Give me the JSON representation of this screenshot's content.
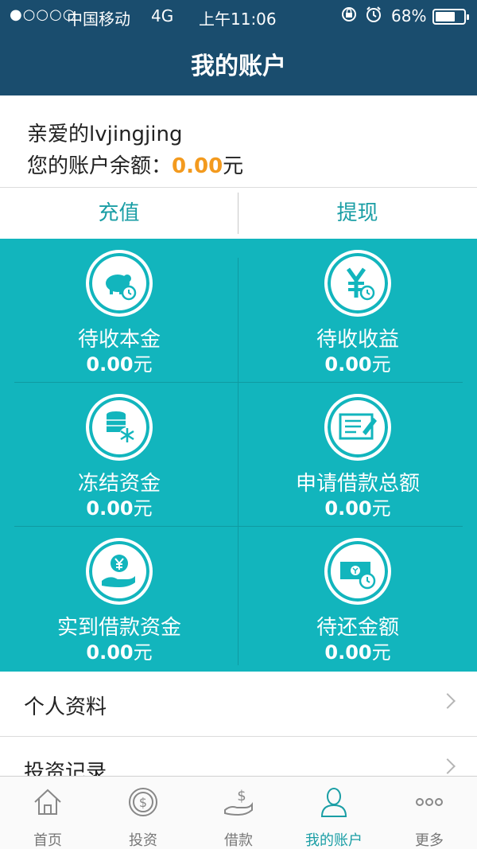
{
  "status_bar": {
    "signal": "●○○○○",
    "carrier": "中国移动",
    "network": "4G",
    "time": "上午11:06",
    "battery": "68%"
  },
  "nav": {
    "title": "我的账户"
  },
  "greeting": {
    "prefix": "亲爱的",
    "username": "lvjingjing",
    "balance_label": "您的账户余额：",
    "balance_value": "0.00",
    "balance_unit": "元"
  },
  "actions": {
    "recharge": "充值",
    "withdraw": "提现"
  },
  "stats": [
    {
      "label": "待收本金",
      "value": "0.00",
      "unit": "元",
      "icon": "piggy-bank-clock-icon"
    },
    {
      "label": "待收收益",
      "value": "0.00",
      "unit": "元",
      "icon": "yuan-clock-icon"
    },
    {
      "label": "冻结资金",
      "value": "0.00",
      "unit": "元",
      "icon": "frozen-coins-icon"
    },
    {
      "label": "申请借款总额",
      "value": "0.00",
      "unit": "元",
      "icon": "loan-application-icon"
    },
    {
      "label": "实到借款资金",
      "value": "0.00",
      "unit": "元",
      "icon": "hand-coin-icon"
    },
    {
      "label": "待还金额",
      "value": "0.00",
      "unit": "元",
      "icon": "money-clock-icon"
    }
  ],
  "menu": [
    {
      "label": "个人资料"
    },
    {
      "label": "投资记录"
    }
  ],
  "tabs": [
    {
      "label": "首页",
      "icon": "home-icon"
    },
    {
      "label": "投资",
      "icon": "dollar-coin-icon"
    },
    {
      "label": "借款",
      "icon": "hand-money-icon"
    },
    {
      "label": "我的账户",
      "icon": "user-icon",
      "active": true
    },
    {
      "label": "更多",
      "icon": "more-icon"
    }
  ],
  "colors": {
    "header_bg": "#1a4d6e",
    "grid_bg": "#12b5bd",
    "accent": "#1a9ea5",
    "balance": "#f39a1e"
  }
}
